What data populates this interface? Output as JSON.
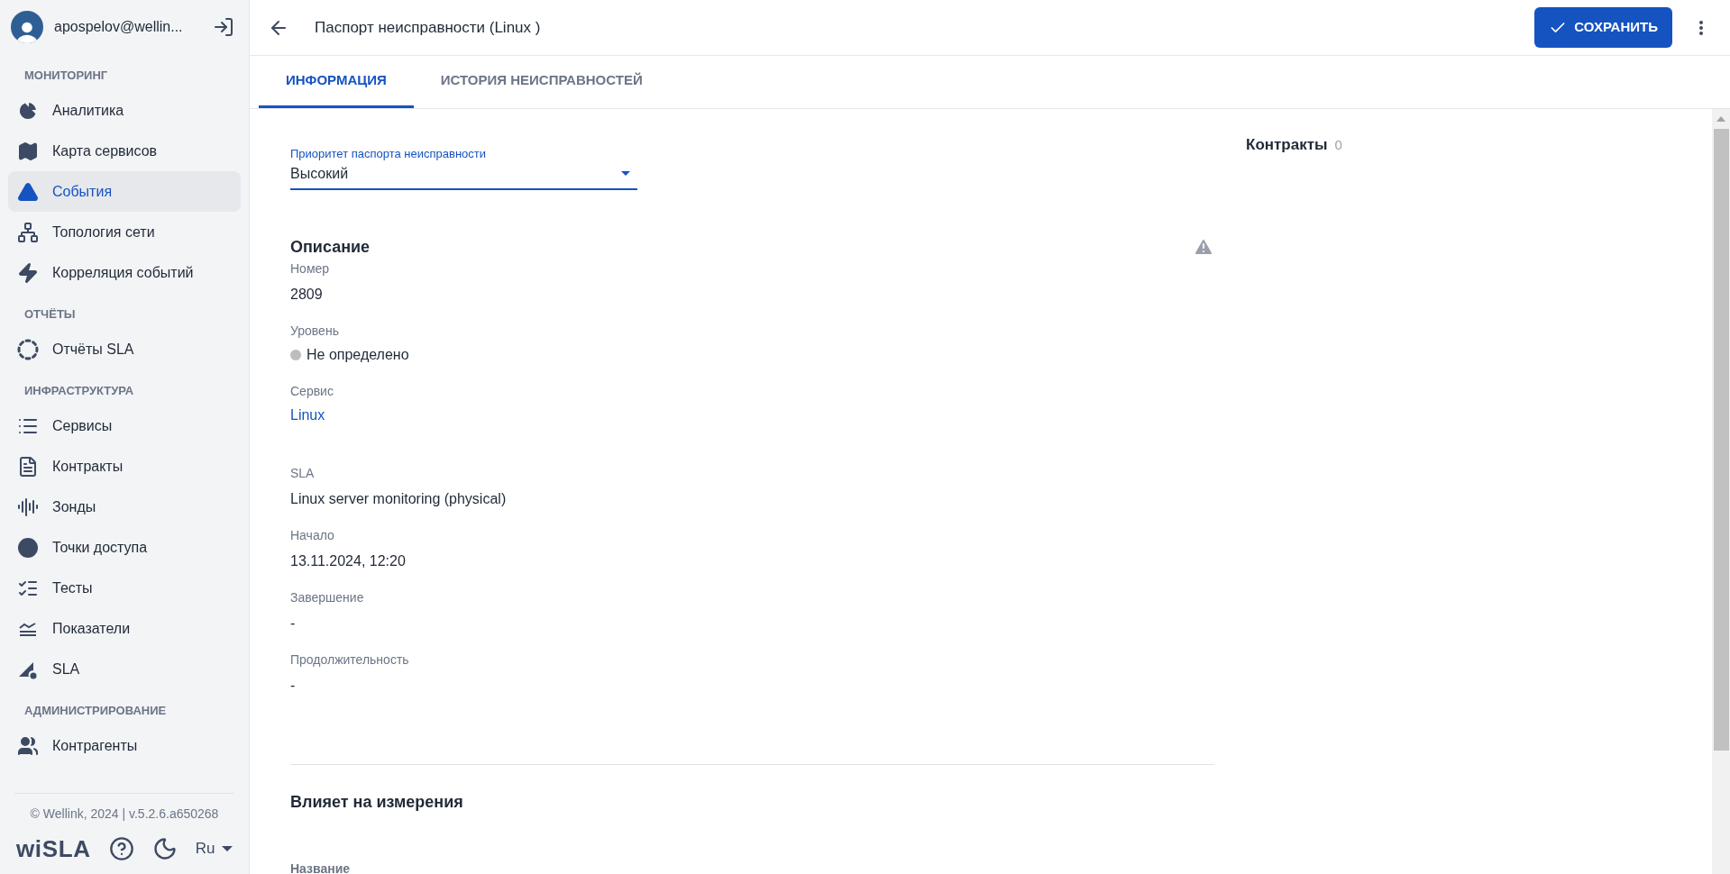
{
  "user": {
    "name": "apospelov@wellin..."
  },
  "sidebar": {
    "sections": [
      {
        "title": "МОНИТОРИНГ",
        "items": [
          {
            "label": "Аналитика",
            "selected": false
          },
          {
            "label": "Карта сервисов",
            "selected": false
          },
          {
            "label": "События",
            "selected": true
          },
          {
            "label": "Топология сети",
            "selected": false
          },
          {
            "label": "Корреляция событий",
            "selected": false
          }
        ]
      },
      {
        "title": "ОТЧЁТЫ",
        "items": [
          {
            "label": "Отчёты SLA",
            "selected": false
          }
        ]
      },
      {
        "title": "ИНФРАСТРУКТУРА",
        "items": [
          {
            "label": "Сервисы",
            "selected": false
          },
          {
            "label": "Контракты",
            "selected": false
          },
          {
            "label": "Зонды",
            "selected": false
          },
          {
            "label": "Точки доступа",
            "selected": false
          },
          {
            "label": "Тесты",
            "selected": false
          },
          {
            "label": "Показатели",
            "selected": false
          },
          {
            "label": "SLA",
            "selected": false
          }
        ]
      },
      {
        "title": "АДМИНИСТРИРОВАНИЕ",
        "items": [
          {
            "label": "Контрагенты",
            "selected": false
          }
        ]
      }
    ],
    "footer": {
      "copyright": "© Wellink, 2024 | v.5.2.6.a650268",
      "logo": "wiSLA",
      "language": "Ru"
    }
  },
  "header": {
    "title": "Паспорт неисправности (Linux )",
    "save_button": "СОХРАНИТЬ"
  },
  "tabs": [
    {
      "label": "ИНФОРМАЦИЯ",
      "selected": true
    },
    {
      "label": "ИСТОРИЯ НЕИСПРАВНОСТЕЙ",
      "selected": false
    }
  ],
  "priority": {
    "label": "Приоритет паспорта неисправности",
    "value": "Высокий"
  },
  "description": {
    "title": "Описание",
    "fields": [
      {
        "label": "Номер",
        "value": "2809",
        "kind": "text"
      },
      {
        "label": "Уровень",
        "value": "Не определено",
        "kind": "status",
        "color": "#bdbdbd"
      },
      {
        "label": "Сервис",
        "value": "Linux",
        "kind": "link"
      },
      {
        "label": "SLA",
        "value": "Linux server monitoring (physical)",
        "kind": "text"
      },
      {
        "label": "Начало",
        "value": "13.11.2024, 12:20",
        "kind": "text"
      },
      {
        "label": "Завершение",
        "value": "-",
        "kind": "text"
      },
      {
        "label": "Продолжительность",
        "value": "-",
        "kind": "text"
      }
    ]
  },
  "impact": {
    "title": "Влияет на измерения",
    "column_1": "Название"
  },
  "contracts": {
    "title": "Контракты",
    "count": "0"
  }
}
